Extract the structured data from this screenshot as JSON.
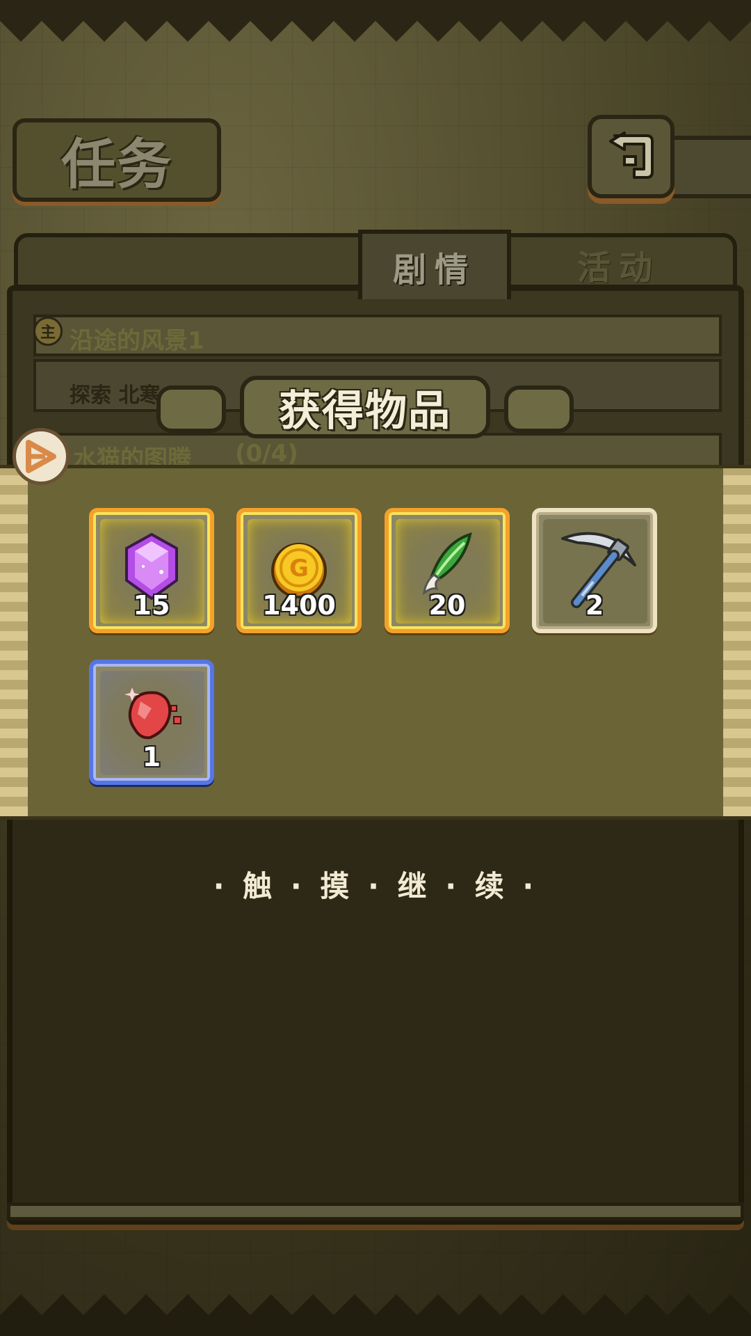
{
  "screen": {
    "title": "任务",
    "back_icon": "return-arrow-icon"
  },
  "tabs": [
    {
      "label": "剧情",
      "active": true
    },
    {
      "label": "活动",
      "active": false
    }
  ],
  "quests": [
    {
      "badge": "主",
      "title": "沿途的风景1",
      "description": "探索 北寒"
    },
    {
      "badge_icon": "side-quest-icon",
      "title": "水猫的图腾",
      "progress": "(0/4)"
    }
  ],
  "reward_popup": {
    "title": "获得物品",
    "items": [
      {
        "icon": "purple-gem-icon",
        "count": "15",
        "rarity": "gold"
      },
      {
        "icon": "gold-coin-icon",
        "count": "1400",
        "rarity": "gold"
      },
      {
        "icon": "green-feather-icon",
        "count": "20",
        "rarity": "gold"
      },
      {
        "icon": "pickaxe-icon",
        "count": "2",
        "rarity": "white"
      },
      {
        "icon": "red-ore-icon",
        "count": "1",
        "rarity": "blue"
      }
    ],
    "continue_text": "· 触 · 摸 · 继 · 续 ·"
  },
  "colors": {
    "gold_frame": "#f3a12a",
    "blue_frame": "#5676e6",
    "white_frame": "#ede2c4",
    "panel_dark": "#3b3720"
  }
}
